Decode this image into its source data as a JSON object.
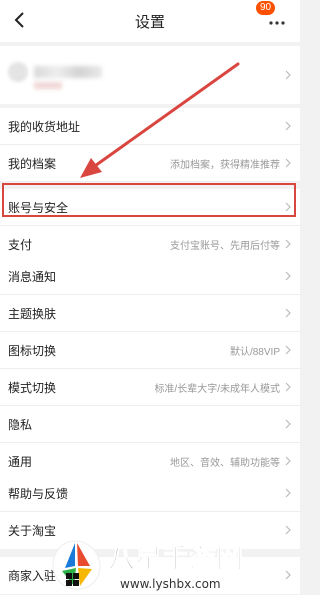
{
  "header": {
    "title": "设置",
    "badge": "90"
  },
  "groups": [
    {
      "items": [
        {
          "label": "我的收货地址",
          "value": ""
        },
        {
          "label": "我的档案",
          "value": "添加档案，获得精准推荐"
        },
        {
          "label": "账号与安全",
          "value": ""
        },
        {
          "label": "支付",
          "value": "支付宝账号、先用后付等"
        }
      ]
    },
    {
      "items": [
        {
          "label": "消息通知",
          "value": ""
        },
        {
          "label": "主题换肤",
          "value": ""
        },
        {
          "label": "图标切换",
          "value": "默认/88VIP"
        },
        {
          "label": "模式切换",
          "value": "标准/长辈大字/未成年人模式"
        },
        {
          "label": "隐私",
          "value": ""
        },
        {
          "label": "通用",
          "value": "地区、音效、辅助功能等"
        }
      ]
    },
    {
      "items": [
        {
          "label": "帮助与反馈",
          "value": ""
        },
        {
          "label": "关于淘宝",
          "value": ""
        }
      ]
    },
    {
      "items": [
        {
          "label": "商家入驻",
          "value": ""
        }
      ]
    }
  ],
  "annotation": {
    "highlight_color": "#d9463f"
  },
  "watermark": {
    "brand": "八星手游网",
    "url": "www.lyshbx.com"
  }
}
